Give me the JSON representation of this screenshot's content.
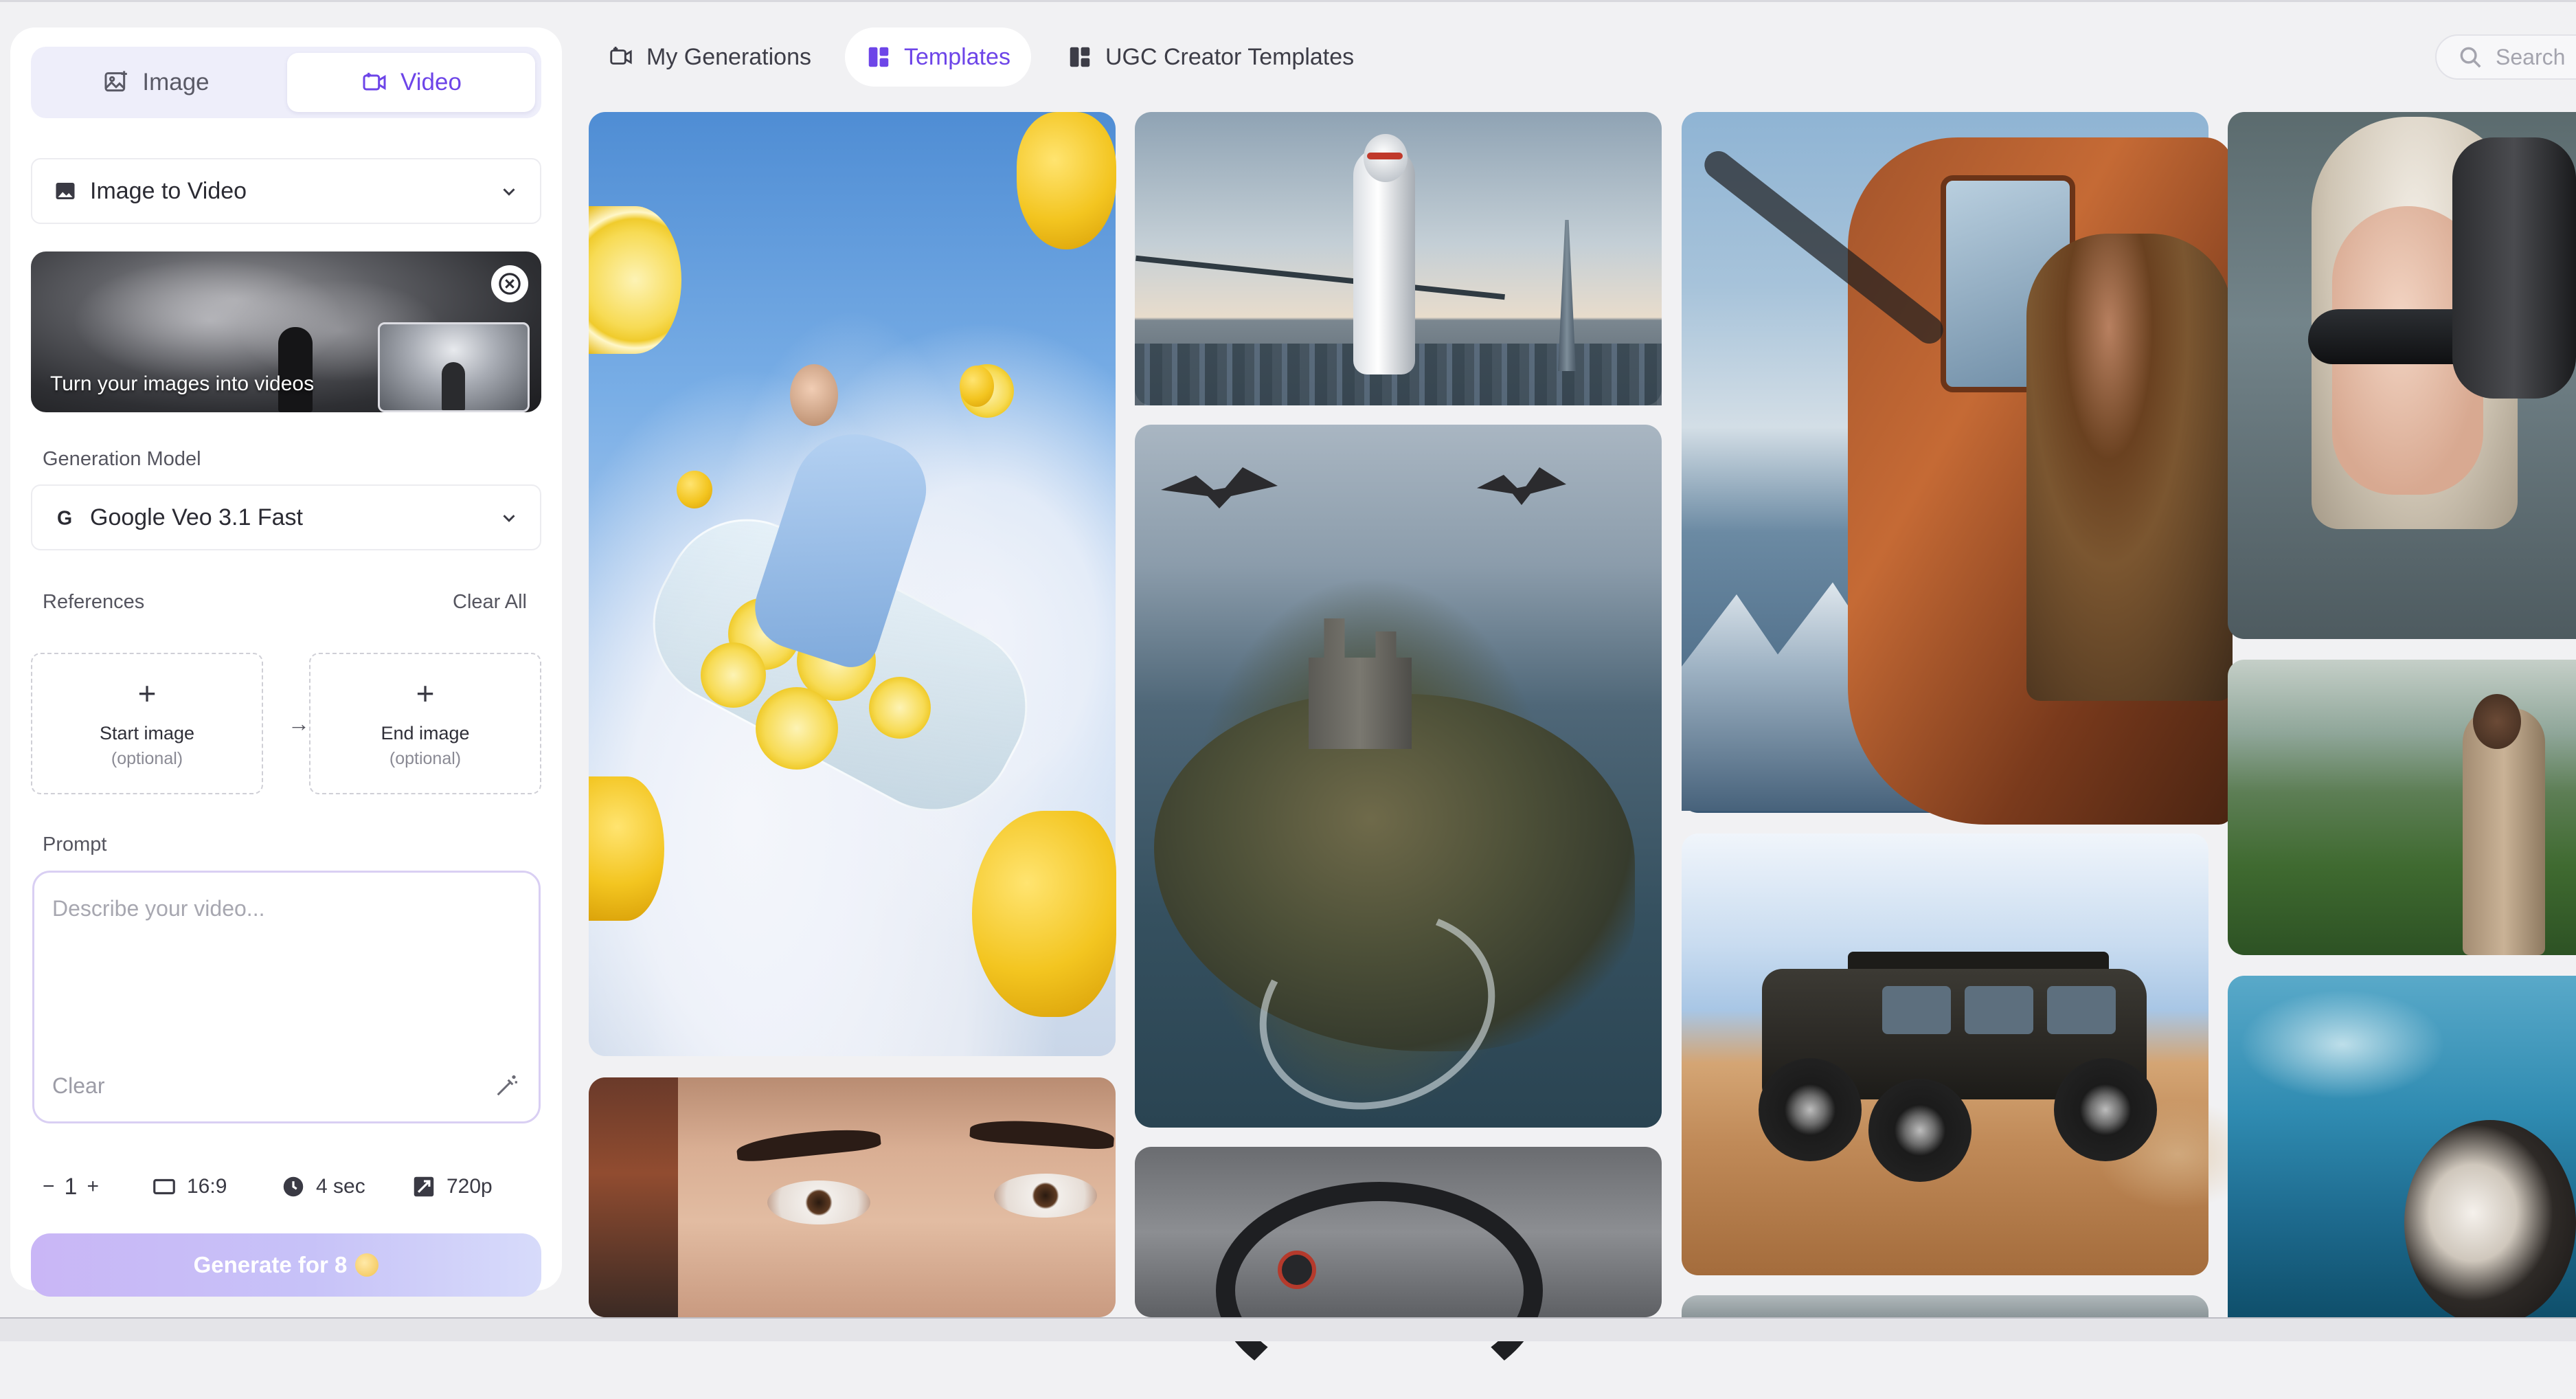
{
  "sidebar": {
    "mode_tabs": [
      {
        "label": "Image",
        "icon": "image-icon",
        "active": false
      },
      {
        "label": "Video",
        "icon": "video-icon",
        "active": true
      }
    ],
    "workflow_select": {
      "value": "Image to Video",
      "icon": "image-icon"
    },
    "banner": {
      "caption": "Turn your images into videos"
    },
    "model": {
      "label": "Generation Model",
      "value": "Google Veo 3.1 Fast",
      "icon": "google-icon"
    },
    "references": {
      "label": "References",
      "clear_all": "Clear All",
      "start": {
        "title": "Start image",
        "sub": "(optional)"
      },
      "end": {
        "title": "End image",
        "sub": "(optional)"
      },
      "arrow": "→"
    },
    "prompt": {
      "label": "Prompt",
      "placeholder": "Describe your video...",
      "clear": "Clear"
    },
    "options": {
      "count_minus": "−",
      "count": "1",
      "count_plus": "+",
      "aspect": "16:9",
      "duration": "4 sec",
      "resolution": "720p"
    },
    "generate": {
      "label": "Generate for 8",
      "icon": "coin-icon"
    }
  },
  "nav": {
    "tabs": [
      {
        "label": "My Generations",
        "icon": "generations-icon",
        "active": false
      },
      {
        "label": "Templates",
        "icon": "templates-icon",
        "active": true
      },
      {
        "label": "UGC Creator Templates",
        "icon": "templates-icon",
        "active": false
      }
    ],
    "search_placeholder": "Search"
  },
  "colors": {
    "accent": "#6d45e8",
    "page_bg": "#f1f1f3",
    "panel_bg": "#ffffff",
    "generate_gradient_start": "#c9b6f6"
  },
  "gallery": {
    "tiles": [
      {
        "name": "template-lemon-sky"
      },
      {
        "name": "template-robot-city"
      },
      {
        "name": "template-castle-coast"
      },
      {
        "name": "template-watch"
      },
      {
        "name": "template-eyes-closeup"
      },
      {
        "name": "template-airplane-pilot"
      },
      {
        "name": "template-desert-suv"
      },
      {
        "name": "template-sunglasses-woman"
      },
      {
        "name": "template-field-man"
      },
      {
        "name": "template-water-dog"
      }
    ]
  }
}
